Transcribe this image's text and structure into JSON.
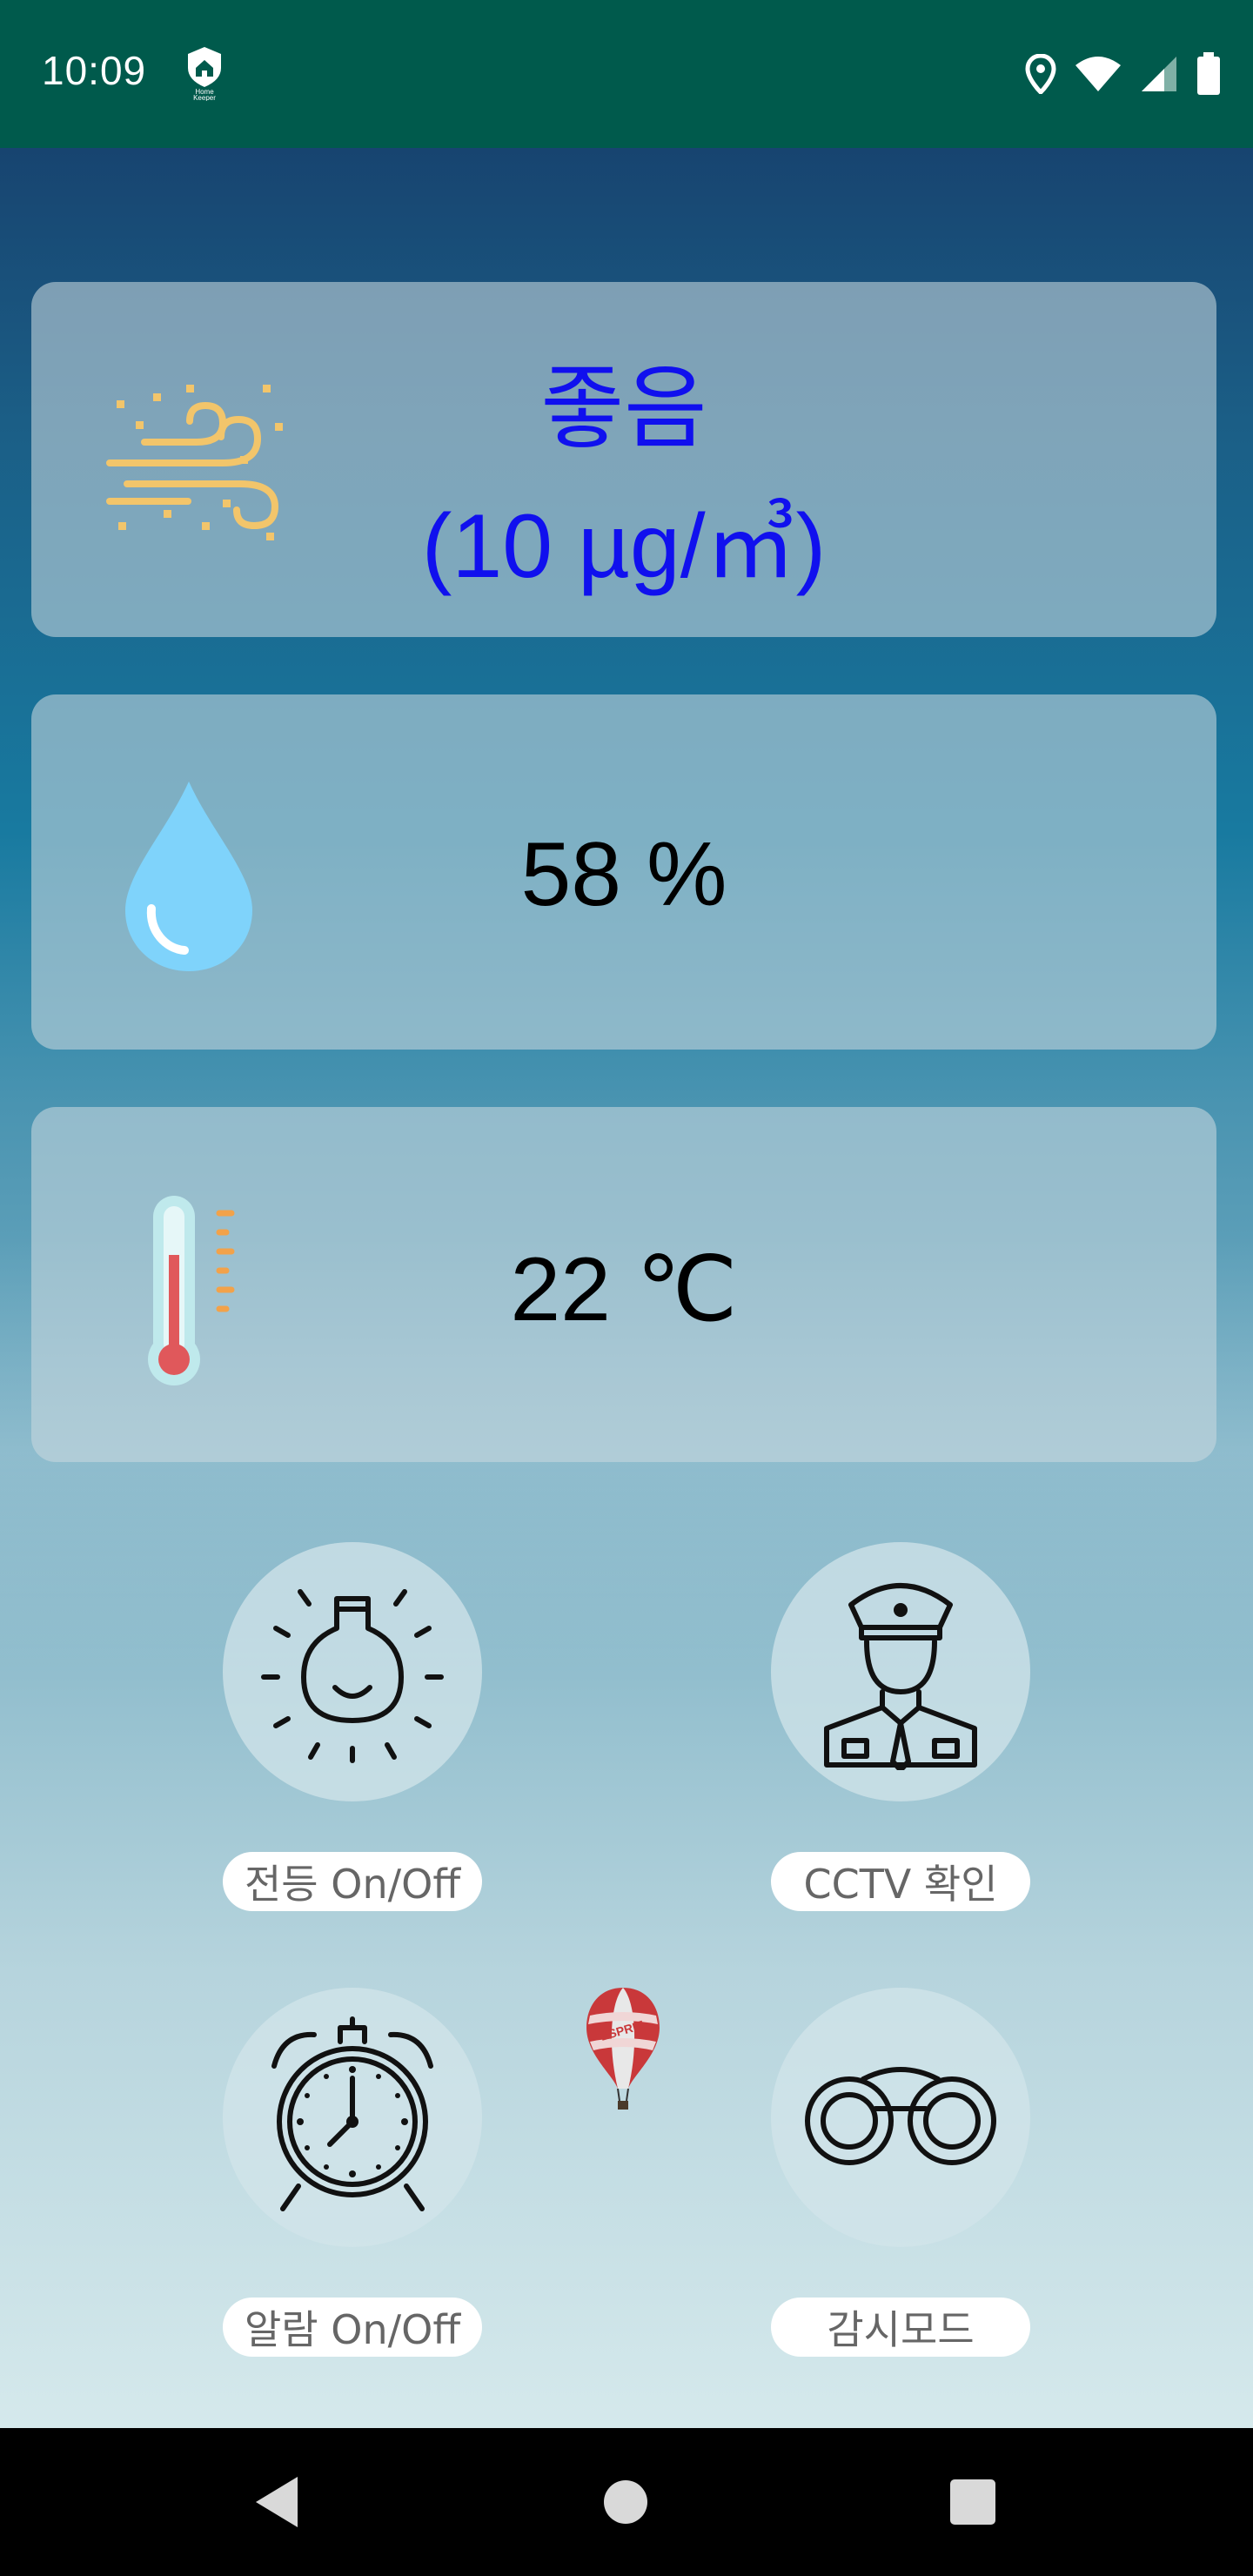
{
  "status_bar": {
    "time": "10:09",
    "app_icon_text": "Home Keeper",
    "icons": [
      "location-icon",
      "wifi-icon",
      "signal-icon",
      "battery-icon"
    ]
  },
  "air_quality": {
    "icon": "wind-dust-icon",
    "status": "좋음",
    "value": "(10 µg/㎥)",
    "text_color": "#1010ee"
  },
  "humidity": {
    "icon": "water-drop-icon",
    "value": "58 %"
  },
  "temperature": {
    "icon": "thermometer-icon",
    "value": "22 ℃"
  },
  "controls": [
    {
      "icon": "light-bulb-icon",
      "label": "전등 On/Off"
    },
    {
      "icon": "security-guard-icon",
      "label": "CCTV 확인"
    },
    {
      "icon": "alarm-clock-icon",
      "label": "알람 On/Off"
    },
    {
      "icon": "binoculars-icon",
      "label": "감시모드"
    }
  ],
  "decoration": {
    "balloon_text": "ESPRIT"
  },
  "nav_bar": {
    "icons": [
      "back-icon",
      "home-icon",
      "recent-apps-icon"
    ]
  }
}
